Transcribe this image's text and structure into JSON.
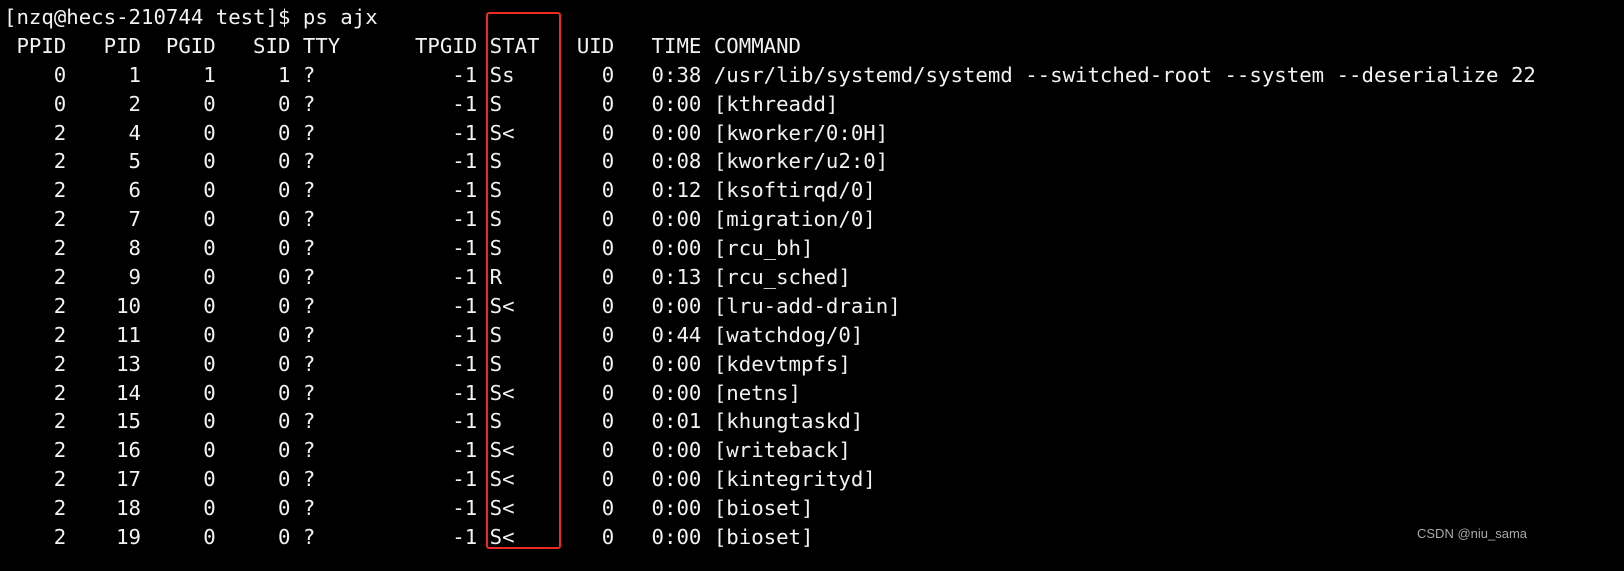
{
  "prompt": "[nzq@hecs-210744 test]$ ps ajx",
  "header": {
    "ppid": "PPID",
    "pid": "PID",
    "pgid": "PGID",
    "sid": "SID",
    "tty": "TTY",
    "tpgid": "TPGID",
    "stat": "STAT",
    "uid": "UID",
    "time": "TIME",
    "command": "COMMAND"
  },
  "rows": [
    {
      "ppid": "0",
      "pid": "1",
      "pgid": "1",
      "sid": "1",
      "tty": "?",
      "tpgid": "-1",
      "stat": "Ss",
      "uid": "0",
      "time": "0:38",
      "command": "/usr/lib/systemd/systemd --switched-root --system --deserialize 22"
    },
    {
      "ppid": "0",
      "pid": "2",
      "pgid": "0",
      "sid": "0",
      "tty": "?",
      "tpgid": "-1",
      "stat": "S",
      "uid": "0",
      "time": "0:00",
      "command": "[kthreadd]"
    },
    {
      "ppid": "2",
      "pid": "4",
      "pgid": "0",
      "sid": "0",
      "tty": "?",
      "tpgid": "-1",
      "stat": "S<",
      "uid": "0",
      "time": "0:00",
      "command": "[kworker/0:0H]"
    },
    {
      "ppid": "2",
      "pid": "5",
      "pgid": "0",
      "sid": "0",
      "tty": "?",
      "tpgid": "-1",
      "stat": "S",
      "uid": "0",
      "time": "0:08",
      "command": "[kworker/u2:0]"
    },
    {
      "ppid": "2",
      "pid": "6",
      "pgid": "0",
      "sid": "0",
      "tty": "?",
      "tpgid": "-1",
      "stat": "S",
      "uid": "0",
      "time": "0:12",
      "command": "[ksoftirqd/0]"
    },
    {
      "ppid": "2",
      "pid": "7",
      "pgid": "0",
      "sid": "0",
      "tty": "?",
      "tpgid": "-1",
      "stat": "S",
      "uid": "0",
      "time": "0:00",
      "command": "[migration/0]"
    },
    {
      "ppid": "2",
      "pid": "8",
      "pgid": "0",
      "sid": "0",
      "tty": "?",
      "tpgid": "-1",
      "stat": "S",
      "uid": "0",
      "time": "0:00",
      "command": "[rcu_bh]"
    },
    {
      "ppid": "2",
      "pid": "9",
      "pgid": "0",
      "sid": "0",
      "tty": "?",
      "tpgid": "-1",
      "stat": "R",
      "uid": "0",
      "time": "0:13",
      "command": "[rcu_sched]"
    },
    {
      "ppid": "2",
      "pid": "10",
      "pgid": "0",
      "sid": "0",
      "tty": "?",
      "tpgid": "-1",
      "stat": "S<",
      "uid": "0",
      "time": "0:00",
      "command": "[lru-add-drain]"
    },
    {
      "ppid": "2",
      "pid": "11",
      "pgid": "0",
      "sid": "0",
      "tty": "?",
      "tpgid": "-1",
      "stat": "S",
      "uid": "0",
      "time": "0:44",
      "command": "[watchdog/0]"
    },
    {
      "ppid": "2",
      "pid": "13",
      "pgid": "0",
      "sid": "0",
      "tty": "?",
      "tpgid": "-1",
      "stat": "S",
      "uid": "0",
      "time": "0:00",
      "command": "[kdevtmpfs]"
    },
    {
      "ppid": "2",
      "pid": "14",
      "pgid": "0",
      "sid": "0",
      "tty": "?",
      "tpgid": "-1",
      "stat": "S<",
      "uid": "0",
      "time": "0:00",
      "command": "[netns]"
    },
    {
      "ppid": "2",
      "pid": "15",
      "pgid": "0",
      "sid": "0",
      "tty": "?",
      "tpgid": "-1",
      "stat": "S",
      "uid": "0",
      "time": "0:01",
      "command": "[khungtaskd]"
    },
    {
      "ppid": "2",
      "pid": "16",
      "pgid": "0",
      "sid": "0",
      "tty": "?",
      "tpgid": "-1",
      "stat": "S<",
      "uid": "0",
      "time": "0:00",
      "command": "[writeback]"
    },
    {
      "ppid": "2",
      "pid": "17",
      "pgid": "0",
      "sid": "0",
      "tty": "?",
      "tpgid": "-1",
      "stat": "S<",
      "uid": "0",
      "time": "0:00",
      "command": "[kintegrityd]"
    },
    {
      "ppid": "2",
      "pid": "18",
      "pgid": "0",
      "sid": "0",
      "tty": "?",
      "tpgid": "-1",
      "stat": "S<",
      "uid": "0",
      "time": "0:00",
      "command": "[bioset]"
    },
    {
      "ppid": "2",
      "pid": "19",
      "pgid": "0",
      "sid": "0",
      "tty": "?",
      "tpgid": "-1",
      "stat": "S<",
      "uid": "0",
      "time": "0:00",
      "command": "[bioset]"
    }
  ],
  "highlight_color": "#ec2a22",
  "watermark": "CSDN @niu_sama"
}
